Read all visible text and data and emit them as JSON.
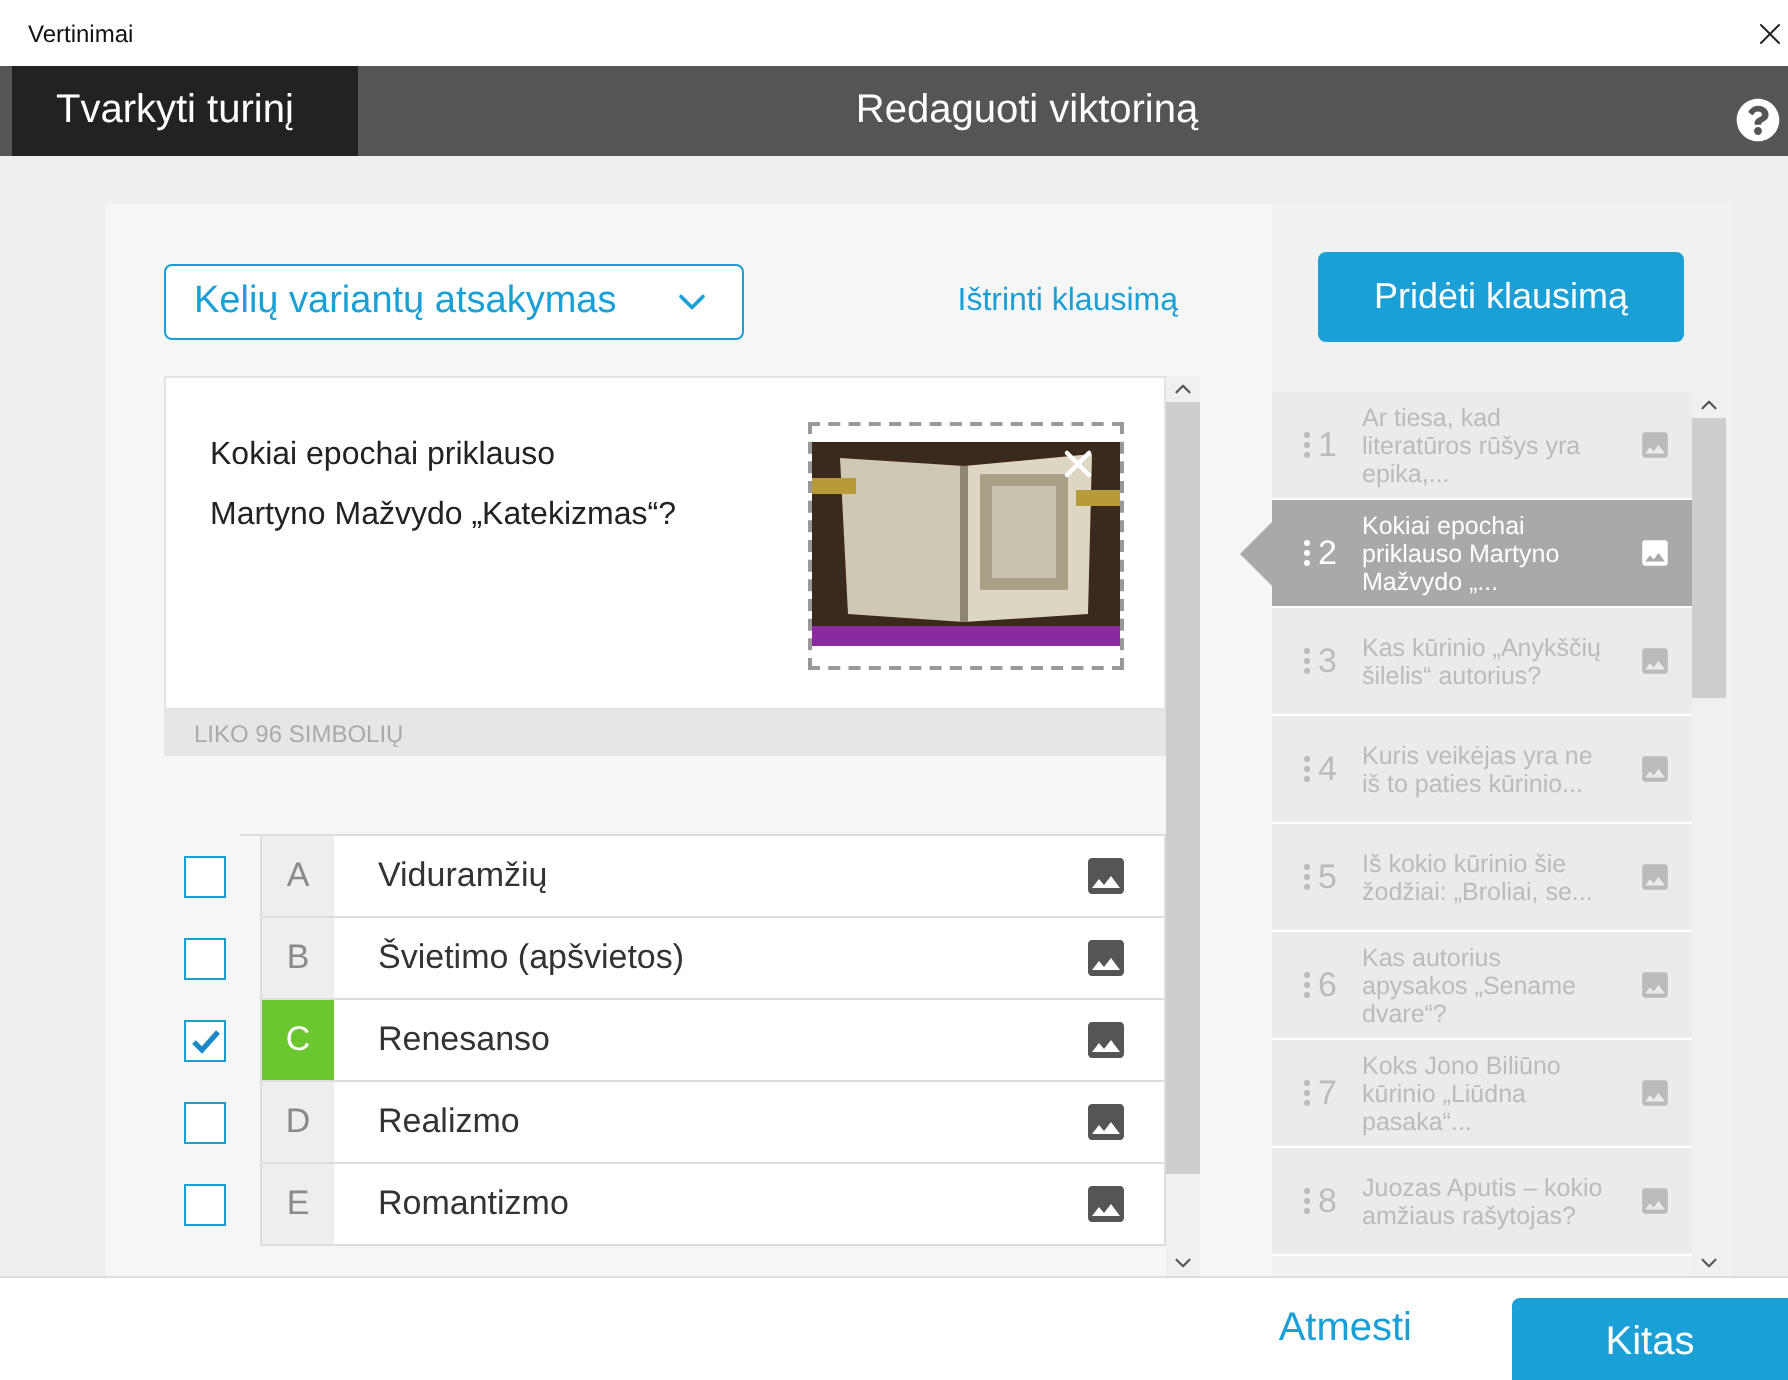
{
  "window": {
    "title": "Vertinimai"
  },
  "header": {
    "tabs": [
      {
        "label": "Tvarkyti turinį",
        "selected": true
      }
    ],
    "title": "Redaguoti viktoriną"
  },
  "editor": {
    "question_type": "Kelių variantų atsakymas",
    "delete_link": "Ištrinti klausimą",
    "question": {
      "text": "Kokiai epochai priklauso\nMartyno Mažvydo „Katekizmas“?",
      "counter": "LIKO 96 SIMBOLIŲ"
    },
    "answers": [
      {
        "letter": "A",
        "text": "Viduramžių",
        "checked": false
      },
      {
        "letter": "B",
        "text": "Švietimo (apšvietos)",
        "checked": false
      },
      {
        "letter": "C",
        "text": "Renesanso",
        "checked": true
      },
      {
        "letter": "D",
        "text": "Realizmo",
        "checked": false
      },
      {
        "letter": "E",
        "text": "Romantizmo",
        "checked": false
      }
    ]
  },
  "sidebar": {
    "add_button": "Pridėti klausimą",
    "questions": [
      {
        "number": "1",
        "text": "Ar tiesa, kad literatūros rūšys yra epika,...",
        "selected": false
      },
      {
        "number": "2",
        "text": "Kokiai epochai priklauso Martyno Mažvydo „...",
        "selected": true
      },
      {
        "number": "3",
        "text": "Kas kūrinio „Anykščių šilelis“ autorius?",
        "selected": false
      },
      {
        "number": "4",
        "text": "Kuris veikėjas yra ne iš to paties kūrinio...",
        "selected": false
      },
      {
        "number": "5",
        "text": "Iš kokio kūrinio šie žodžiai: „Broliai, se...",
        "selected": false
      },
      {
        "number": "6",
        "text": "Kas autorius apysakos „Sename dvare“?",
        "selected": false
      },
      {
        "number": "7",
        "text": "Koks Jono Biliūno kūrinio „Liūdna pasaka“...",
        "selected": false
      },
      {
        "number": "8",
        "text": "Juozas Aputis – kokio amžiaus rašytojas?",
        "selected": false
      }
    ]
  },
  "footer": {
    "buttons": [
      {
        "label": "Atmesti",
        "kind": "link"
      },
      {
        "label": "Kitas",
        "kind": "primary"
      }
    ]
  }
}
